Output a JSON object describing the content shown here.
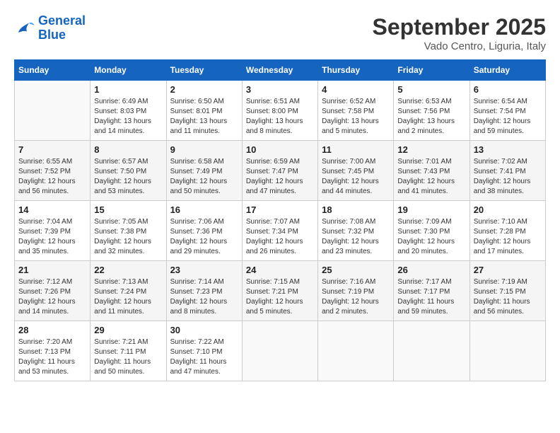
{
  "logo": {
    "line1": "General",
    "line2": "Blue"
  },
  "title": "September 2025",
  "subtitle": "Vado Centro, Liguria, Italy",
  "days_of_week": [
    "Sunday",
    "Monday",
    "Tuesday",
    "Wednesday",
    "Thursday",
    "Friday",
    "Saturday"
  ],
  "weeks": [
    [
      {
        "day": "",
        "info": ""
      },
      {
        "day": "1",
        "info": "Sunrise: 6:49 AM\nSunset: 8:03 PM\nDaylight: 13 hours\nand 14 minutes."
      },
      {
        "day": "2",
        "info": "Sunrise: 6:50 AM\nSunset: 8:01 PM\nDaylight: 13 hours\nand 11 minutes."
      },
      {
        "day": "3",
        "info": "Sunrise: 6:51 AM\nSunset: 8:00 PM\nDaylight: 13 hours\nand 8 minutes."
      },
      {
        "day": "4",
        "info": "Sunrise: 6:52 AM\nSunset: 7:58 PM\nDaylight: 13 hours\nand 5 minutes."
      },
      {
        "day": "5",
        "info": "Sunrise: 6:53 AM\nSunset: 7:56 PM\nDaylight: 13 hours\nand 2 minutes."
      },
      {
        "day": "6",
        "info": "Sunrise: 6:54 AM\nSunset: 7:54 PM\nDaylight: 12 hours\nand 59 minutes."
      }
    ],
    [
      {
        "day": "7",
        "info": "Sunrise: 6:55 AM\nSunset: 7:52 PM\nDaylight: 12 hours\nand 56 minutes."
      },
      {
        "day": "8",
        "info": "Sunrise: 6:57 AM\nSunset: 7:50 PM\nDaylight: 12 hours\nand 53 minutes."
      },
      {
        "day": "9",
        "info": "Sunrise: 6:58 AM\nSunset: 7:49 PM\nDaylight: 12 hours\nand 50 minutes."
      },
      {
        "day": "10",
        "info": "Sunrise: 6:59 AM\nSunset: 7:47 PM\nDaylight: 12 hours\nand 47 minutes."
      },
      {
        "day": "11",
        "info": "Sunrise: 7:00 AM\nSunset: 7:45 PM\nDaylight: 12 hours\nand 44 minutes."
      },
      {
        "day": "12",
        "info": "Sunrise: 7:01 AM\nSunset: 7:43 PM\nDaylight: 12 hours\nand 41 minutes."
      },
      {
        "day": "13",
        "info": "Sunrise: 7:02 AM\nSunset: 7:41 PM\nDaylight: 12 hours\nand 38 minutes."
      }
    ],
    [
      {
        "day": "14",
        "info": "Sunrise: 7:04 AM\nSunset: 7:39 PM\nDaylight: 12 hours\nand 35 minutes."
      },
      {
        "day": "15",
        "info": "Sunrise: 7:05 AM\nSunset: 7:38 PM\nDaylight: 12 hours\nand 32 minutes."
      },
      {
        "day": "16",
        "info": "Sunrise: 7:06 AM\nSunset: 7:36 PM\nDaylight: 12 hours\nand 29 minutes."
      },
      {
        "day": "17",
        "info": "Sunrise: 7:07 AM\nSunset: 7:34 PM\nDaylight: 12 hours\nand 26 minutes."
      },
      {
        "day": "18",
        "info": "Sunrise: 7:08 AM\nSunset: 7:32 PM\nDaylight: 12 hours\nand 23 minutes."
      },
      {
        "day": "19",
        "info": "Sunrise: 7:09 AM\nSunset: 7:30 PM\nDaylight: 12 hours\nand 20 minutes."
      },
      {
        "day": "20",
        "info": "Sunrise: 7:10 AM\nSunset: 7:28 PM\nDaylight: 12 hours\nand 17 minutes."
      }
    ],
    [
      {
        "day": "21",
        "info": "Sunrise: 7:12 AM\nSunset: 7:26 PM\nDaylight: 12 hours\nand 14 minutes."
      },
      {
        "day": "22",
        "info": "Sunrise: 7:13 AM\nSunset: 7:24 PM\nDaylight: 12 hours\nand 11 minutes."
      },
      {
        "day": "23",
        "info": "Sunrise: 7:14 AM\nSunset: 7:23 PM\nDaylight: 12 hours\nand 8 minutes."
      },
      {
        "day": "24",
        "info": "Sunrise: 7:15 AM\nSunset: 7:21 PM\nDaylight: 12 hours\nand 5 minutes."
      },
      {
        "day": "25",
        "info": "Sunrise: 7:16 AM\nSunset: 7:19 PM\nDaylight: 12 hours\nand 2 minutes."
      },
      {
        "day": "26",
        "info": "Sunrise: 7:17 AM\nSunset: 7:17 PM\nDaylight: 11 hours\nand 59 minutes."
      },
      {
        "day": "27",
        "info": "Sunrise: 7:19 AM\nSunset: 7:15 PM\nDaylight: 11 hours\nand 56 minutes."
      }
    ],
    [
      {
        "day": "28",
        "info": "Sunrise: 7:20 AM\nSunset: 7:13 PM\nDaylight: 11 hours\nand 53 minutes."
      },
      {
        "day": "29",
        "info": "Sunrise: 7:21 AM\nSunset: 7:11 PM\nDaylight: 11 hours\nand 50 minutes."
      },
      {
        "day": "30",
        "info": "Sunrise: 7:22 AM\nSunset: 7:10 PM\nDaylight: 11 hours\nand 47 minutes."
      },
      {
        "day": "",
        "info": ""
      },
      {
        "day": "",
        "info": ""
      },
      {
        "day": "",
        "info": ""
      },
      {
        "day": "",
        "info": ""
      }
    ]
  ]
}
